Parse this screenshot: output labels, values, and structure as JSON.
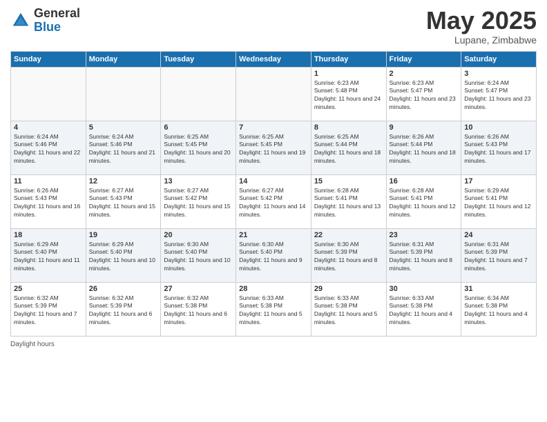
{
  "logo": {
    "general": "General",
    "blue": "Blue"
  },
  "header": {
    "title": "May 2025",
    "subtitle": "Lupane, Zimbabwe"
  },
  "days_of_week": [
    "Sunday",
    "Monday",
    "Tuesday",
    "Wednesday",
    "Thursday",
    "Friday",
    "Saturday"
  ],
  "weeks": [
    [
      {
        "empty": true
      },
      {
        "empty": true
      },
      {
        "empty": true
      },
      {
        "empty": true
      },
      {
        "day": 1,
        "sunrise": "6:23 AM",
        "sunset": "5:48 PM",
        "daylight": "11 hours and 24 minutes."
      },
      {
        "day": 2,
        "sunrise": "6:23 AM",
        "sunset": "5:47 PM",
        "daylight": "11 hours and 23 minutes."
      },
      {
        "day": 3,
        "sunrise": "6:24 AM",
        "sunset": "5:47 PM",
        "daylight": "11 hours and 23 minutes."
      }
    ],
    [
      {
        "day": 4,
        "sunrise": "6:24 AM",
        "sunset": "5:46 PM",
        "daylight": "11 hours and 22 minutes."
      },
      {
        "day": 5,
        "sunrise": "6:24 AM",
        "sunset": "5:46 PM",
        "daylight": "11 hours and 21 minutes."
      },
      {
        "day": 6,
        "sunrise": "6:25 AM",
        "sunset": "5:45 PM",
        "daylight": "11 hours and 20 minutes."
      },
      {
        "day": 7,
        "sunrise": "6:25 AM",
        "sunset": "5:45 PM",
        "daylight": "11 hours and 19 minutes."
      },
      {
        "day": 8,
        "sunrise": "6:25 AM",
        "sunset": "5:44 PM",
        "daylight": "11 hours and 18 minutes."
      },
      {
        "day": 9,
        "sunrise": "6:26 AM",
        "sunset": "5:44 PM",
        "daylight": "11 hours and 18 minutes."
      },
      {
        "day": 10,
        "sunrise": "6:26 AM",
        "sunset": "5:43 PM",
        "daylight": "11 hours and 17 minutes."
      }
    ],
    [
      {
        "day": 11,
        "sunrise": "6:26 AM",
        "sunset": "5:43 PM",
        "daylight": "11 hours and 16 minutes."
      },
      {
        "day": 12,
        "sunrise": "6:27 AM",
        "sunset": "5:43 PM",
        "daylight": "11 hours and 15 minutes."
      },
      {
        "day": 13,
        "sunrise": "6:27 AM",
        "sunset": "5:42 PM",
        "daylight": "11 hours and 15 minutes."
      },
      {
        "day": 14,
        "sunrise": "6:27 AM",
        "sunset": "5:42 PM",
        "daylight": "11 hours and 14 minutes."
      },
      {
        "day": 15,
        "sunrise": "6:28 AM",
        "sunset": "5:41 PM",
        "daylight": "11 hours and 13 minutes."
      },
      {
        "day": 16,
        "sunrise": "6:28 AM",
        "sunset": "5:41 PM",
        "daylight": "11 hours and 12 minutes."
      },
      {
        "day": 17,
        "sunrise": "6:29 AM",
        "sunset": "5:41 PM",
        "daylight": "11 hours and 12 minutes."
      }
    ],
    [
      {
        "day": 18,
        "sunrise": "6:29 AM",
        "sunset": "5:40 PM",
        "daylight": "11 hours and 11 minutes."
      },
      {
        "day": 19,
        "sunrise": "6:29 AM",
        "sunset": "5:40 PM",
        "daylight": "11 hours and 10 minutes."
      },
      {
        "day": 20,
        "sunrise": "6:30 AM",
        "sunset": "5:40 PM",
        "daylight": "11 hours and 10 minutes."
      },
      {
        "day": 21,
        "sunrise": "6:30 AM",
        "sunset": "5:40 PM",
        "daylight": "11 hours and 9 minutes."
      },
      {
        "day": 22,
        "sunrise": "6:30 AM",
        "sunset": "5:39 PM",
        "daylight": "11 hours and 8 minutes."
      },
      {
        "day": 23,
        "sunrise": "6:31 AM",
        "sunset": "5:39 PM",
        "daylight": "11 hours and 8 minutes."
      },
      {
        "day": 24,
        "sunrise": "6:31 AM",
        "sunset": "5:39 PM",
        "daylight": "11 hours and 7 minutes."
      }
    ],
    [
      {
        "day": 25,
        "sunrise": "6:32 AM",
        "sunset": "5:39 PM",
        "daylight": "11 hours and 7 minutes."
      },
      {
        "day": 26,
        "sunrise": "6:32 AM",
        "sunset": "5:39 PM",
        "daylight": "11 hours and 6 minutes."
      },
      {
        "day": 27,
        "sunrise": "6:32 AM",
        "sunset": "5:38 PM",
        "daylight": "11 hours and 6 minutes."
      },
      {
        "day": 28,
        "sunrise": "6:33 AM",
        "sunset": "5:38 PM",
        "daylight": "11 hours and 5 minutes."
      },
      {
        "day": 29,
        "sunrise": "6:33 AM",
        "sunset": "5:38 PM",
        "daylight": "11 hours and 5 minutes."
      },
      {
        "day": 30,
        "sunrise": "6:33 AM",
        "sunset": "5:38 PM",
        "daylight": "11 hours and 4 minutes."
      },
      {
        "day": 31,
        "sunrise": "6:34 AM",
        "sunset": "5:38 PM",
        "daylight": "11 hours and 4 minutes."
      }
    ]
  ],
  "footer": {
    "daylight_label": "Daylight hours"
  }
}
